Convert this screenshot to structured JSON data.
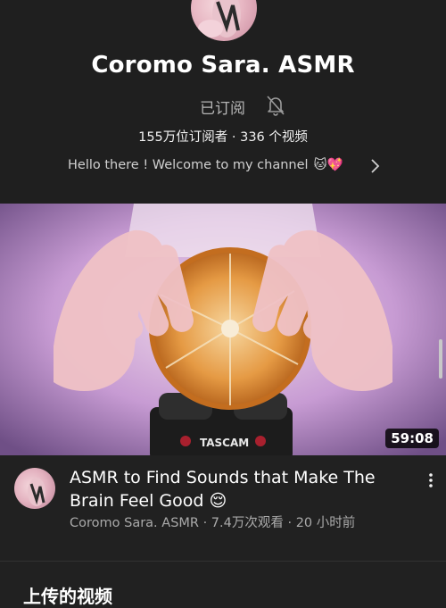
{
  "channel": {
    "name": "Coromo Sara. ASMR",
    "subscribed_label": "已订阅",
    "stats": "155万位订阅者 · 336 个视频",
    "about_text": "Hello there ! Welcome to my channel",
    "about_emoji": "🐱💖"
  },
  "video": {
    "duration": "59:08",
    "title": "ASMR to Find Sounds that Make The Brain Feel Good 😌",
    "meta": "Coromo Sara. ASMR · 7.4万次观看 · 20 小时前",
    "device_label": "TASCAM"
  },
  "section": {
    "heading": "上传的视频"
  },
  "colors": {
    "background": "#212121",
    "header_bg": "#1f1f1f",
    "text_primary": "#ffffff",
    "text_secondary": "#aaaaaa"
  },
  "icons": [
    "bell-off-icon",
    "chevron-right-icon",
    "more-vert-icon"
  ]
}
